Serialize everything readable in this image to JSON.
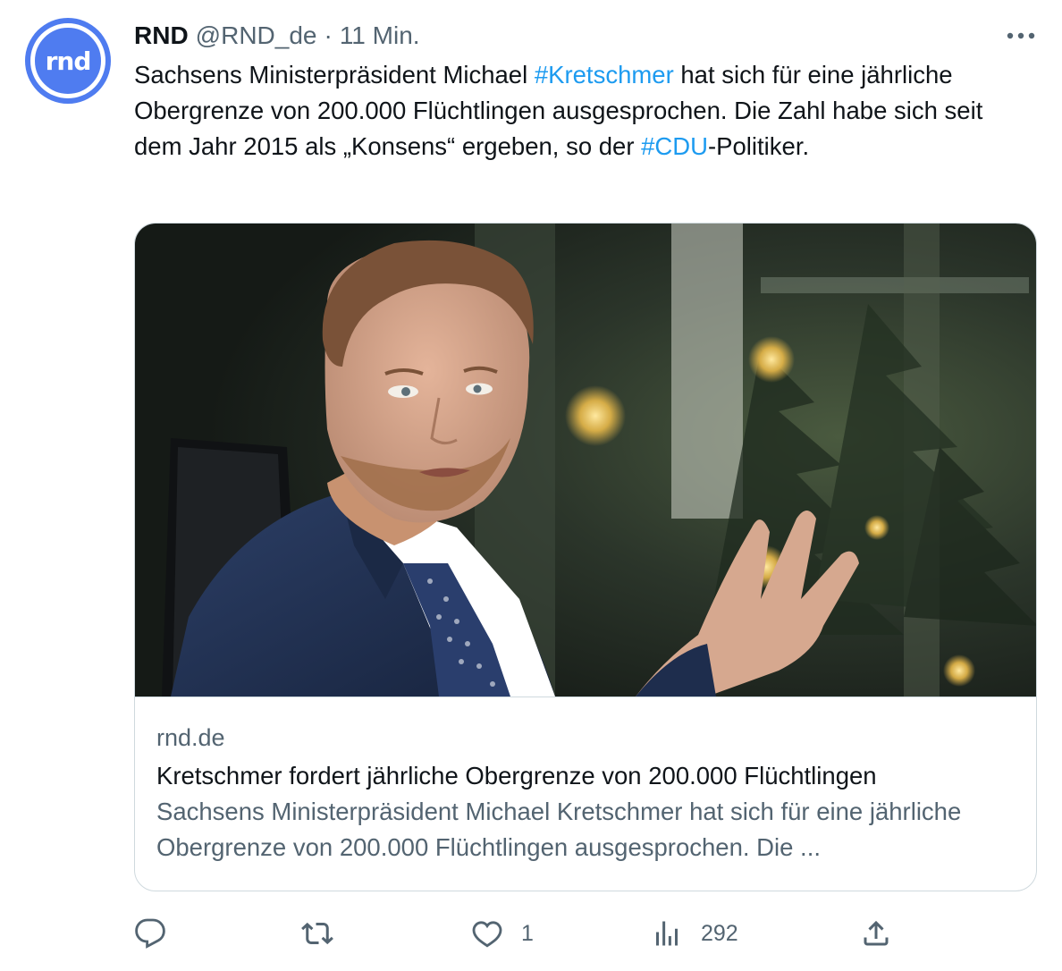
{
  "author": {
    "avatar_text": "rnd",
    "name": "RND",
    "handle": "@RND_de",
    "separator": "·",
    "time": "11 Min."
  },
  "tweet": {
    "segments": [
      {
        "text": "Sachsens Ministerpräsident Michael ",
        "hashtag": false
      },
      {
        "text": "#Kretschmer",
        "hashtag": true
      },
      {
        "text": " hat sich für eine jährliche Obergrenze von 200.000 Flüchtlingen ausgesprochen. Die Zahl habe sich seit dem Jahr 2015 als „Konsens“ ergeben, so der ",
        "hashtag": false
      },
      {
        "text": "#CDU",
        "hashtag": true
      },
      {
        "text": "-Politiker.",
        "hashtag": false
      }
    ]
  },
  "card": {
    "domain": "rnd.de",
    "title": "Kretschmer fordert jährliche Obergrenze von 200.000 Flüchtlingen",
    "description": "Sachsens Ministerpräsident Michael Kretschmer hat sich für eine jährliche Obergrenze von 200.000 Flüchtlingen ausgesprochen. Die ..."
  },
  "actions": {
    "reply": {
      "icon": "reply-icon",
      "count": ""
    },
    "retweet": {
      "icon": "retweet-icon",
      "count": ""
    },
    "like": {
      "icon": "heart-icon",
      "count": "1"
    },
    "views": {
      "icon": "views-icon",
      "count": "292"
    },
    "share": {
      "icon": "share-icon",
      "count": ""
    }
  },
  "colors": {
    "accent": "#1d9bf0",
    "avatar": "#4f7cf0",
    "secondary_text": "#536471",
    "border": "#cfd9de"
  }
}
